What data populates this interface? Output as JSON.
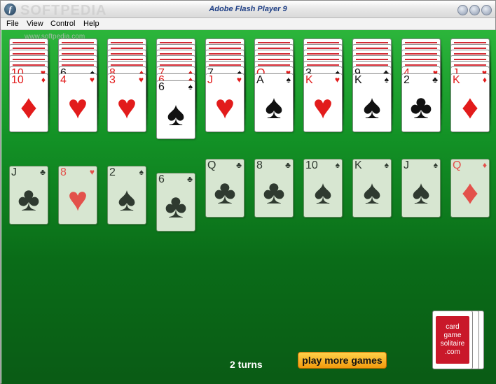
{
  "window": {
    "title": "Adobe Flash Player 9",
    "watermark": "SOFTPEDIA"
  },
  "menu": {
    "file": "File",
    "view": "View",
    "control": "Control",
    "help": "Help"
  },
  "watermark2": "www.softpedia.com",
  "game": {
    "turns": "2 turns",
    "more_games": "play more games",
    "deck_label": [
      "card",
      "game",
      "solitaire",
      ".com"
    ],
    "top_row": [
      {
        "stack": [
          "10♥"
        ],
        "rank": "10",
        "suit": "♦",
        "color": "red"
      },
      {
        "stack": [
          "6♠"
        ],
        "rank": "4",
        "suit": "♥",
        "color": "red"
      },
      {
        "stack": [
          "8♦"
        ],
        "rank": "3",
        "suit": "♥",
        "color": "red"
      },
      {
        "stack": [
          "7♦",
          "6♦"
        ],
        "rank": "6",
        "suit": "♠",
        "color": "black"
      },
      {
        "stack": [
          "7♠"
        ],
        "rank": "J",
        "suit": "♥",
        "color": "red"
      },
      {
        "stack": [
          "Q♥"
        ],
        "rank": "A",
        "suit": "♠",
        "color": "black"
      },
      {
        "stack": [
          "3♠"
        ],
        "rank": "K",
        "suit": "♥",
        "color": "red"
      },
      {
        "stack": [
          "9♣"
        ],
        "rank": "K",
        "suit": "♠",
        "color": "black"
      },
      {
        "stack": [
          "4♥"
        ],
        "rank": "2",
        "suit": "♣",
        "color": "black"
      },
      {
        "stack": [
          "J♥"
        ],
        "rank": "K",
        "suit": "♦",
        "color": "red"
      }
    ],
    "bottom_row": [
      {
        "rank": "J",
        "suit": "♣",
        "color": "black"
      },
      {
        "rank": "8",
        "suit": "♥",
        "color": "red"
      },
      {
        "rank": "2",
        "suit": "♠",
        "color": "black"
      },
      {
        "rank": "6",
        "suit": "♣",
        "color": "black"
      },
      {
        "rank": "Q",
        "suit": "♣",
        "color": "black"
      },
      {
        "rank": "8",
        "suit": "♣",
        "color": "black"
      },
      {
        "rank": "10",
        "suit": "♠",
        "color": "black"
      },
      {
        "rank": "K",
        "suit": "♠",
        "color": "black"
      },
      {
        "rank": "J",
        "suit": "♠",
        "color": "black"
      },
      {
        "rank": "Q",
        "suit": "♦",
        "color": "red"
      }
    ]
  }
}
